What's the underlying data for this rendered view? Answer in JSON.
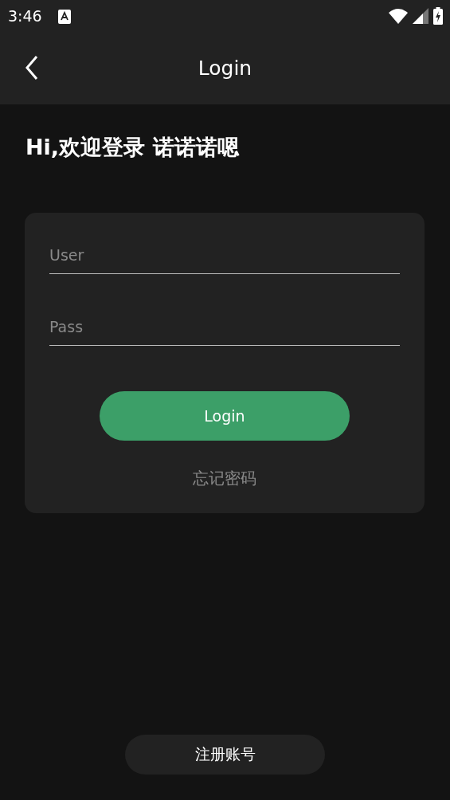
{
  "status_bar": {
    "time": "3:46"
  },
  "app_bar": {
    "title": "Login"
  },
  "greeting": "Hi,欢迎登录 诺诺诺嗯",
  "form": {
    "user": {
      "placeholder": "User"
    },
    "pass": {
      "placeholder": "Pass"
    },
    "login_button": "Login",
    "forgot_link": "忘记密码"
  },
  "register_button": "注册账号"
}
